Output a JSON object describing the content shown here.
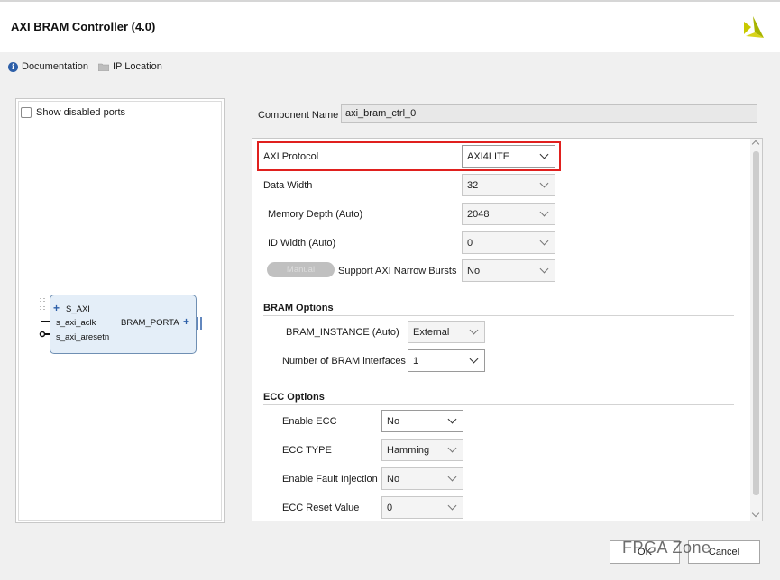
{
  "window": {
    "title": "AXI BRAM Controller (4.0)"
  },
  "toolbar": {
    "documentation": "Documentation",
    "ip_location": "IP Location"
  },
  "symbol": {
    "show_disabled_ports": "Show disabled ports",
    "ports": {
      "s_axi": "S_AXI",
      "s_axi_aclk": "s_axi_aclk",
      "s_axi_aresetn": "s_axi_aresetn",
      "bram_porta": "BRAM_PORTA"
    }
  },
  "component": {
    "label": "Component Name",
    "value": "axi_bram_ctrl_0"
  },
  "params": {
    "axi_protocol": {
      "label": "AXI Protocol",
      "value": "AXI4LITE"
    },
    "data_width": {
      "label": "Data Width",
      "value": "32"
    },
    "memory_depth": {
      "label": "Memory Depth (Auto)",
      "value": "2048"
    },
    "id_width": {
      "label": "ID Width (Auto)",
      "value": "0"
    },
    "narrow_bursts": {
      "toggle": "Manual",
      "label": "Support AXI Narrow Bursts",
      "value": "No"
    }
  },
  "bram_options": {
    "title": "BRAM Options",
    "instance": {
      "label": "BRAM_INSTANCE (Auto)",
      "value": "External"
    },
    "interfaces": {
      "label": "Number of BRAM interfaces",
      "value": "1"
    }
  },
  "ecc_options": {
    "title": "ECC Options",
    "enable_ecc": {
      "label": "Enable ECC",
      "value": "No"
    },
    "ecc_type": {
      "label": "ECC TYPE",
      "value": "Hamming"
    },
    "fault_injection": {
      "label": "Enable Fault Injection",
      "value": "No"
    },
    "reset_value": {
      "label": "ECC Reset Value",
      "value": "0"
    }
  },
  "buttons": {
    "ok": "OK",
    "cancel": "Cancel"
  },
  "watermark": "FPGA Zone",
  "colors": {
    "highlight": "#e0201e",
    "block_fill": "#e4eef8",
    "accent": "#2d5fa8"
  }
}
